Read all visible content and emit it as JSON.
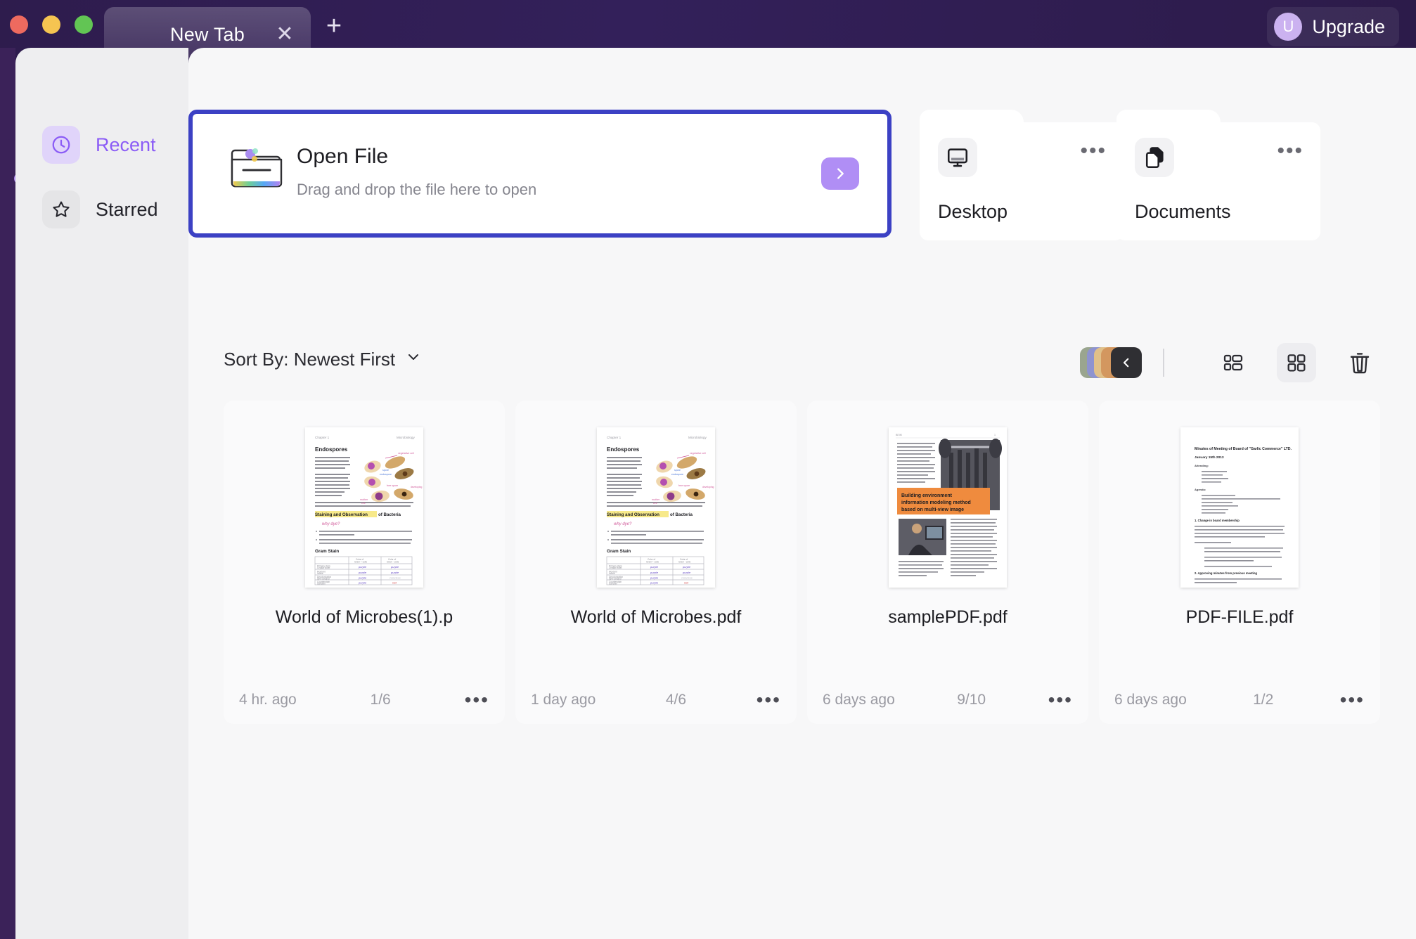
{
  "window": {
    "tab_title": "New Tab",
    "tab_close_icon": "close-icon",
    "new_tab_icon": "plus-icon",
    "upgrade_label": "Upgrade",
    "upgrade_avatar_letter": "U",
    "accent_purple": "#8b5cf6",
    "focus_border": "#3c41c4",
    "titlebar_bg": "#2e1c4d"
  },
  "sidebar": {
    "items": [
      {
        "label": "Recent",
        "icon": "clock-icon",
        "active": true
      },
      {
        "label": "Starred",
        "icon": "star-icon",
        "active": false
      }
    ]
  },
  "open_file": {
    "title": "Open File",
    "subtitle": "Drag and drop the file here to open",
    "icon": "folder-icon",
    "go_icon": "chevron-right-icon"
  },
  "shortcuts": [
    {
      "label": "Desktop",
      "icon": "monitor-icon",
      "menu_icon": "more-horizontal-icon"
    },
    {
      "label": "Documents",
      "icon": "documents-icon",
      "menu_icon": "more-horizontal-icon"
    }
  ],
  "toolbar": {
    "sort_label": "Sort By: Newest First",
    "sort_caret_icon": "chevron-down-icon",
    "color_stack_icon": "chevron-left-icon",
    "color_chips": [
      "#9aa58f",
      "#8e93d0",
      "#e0c089",
      "#d3975f"
    ],
    "list_view_icon": "list-view-icon",
    "grid_view_icon": "grid-view-icon",
    "trash_icon": "trash-icon",
    "active_view": "grid"
  },
  "files": [
    {
      "name": "World of Microbes(1).p",
      "time": "4 hr. ago",
      "pages": "1/6",
      "menu_icon": "more-horizontal-icon",
      "thumb_kind": "microbes",
      "thumb": {
        "heading": "Endospores",
        "highlight": "Staining and Observation of Bacteria",
        "subheading": "Gram Stain"
      }
    },
    {
      "name": "World of Microbes.pdf",
      "time": "1 day ago",
      "pages": "4/6",
      "menu_icon": "more-horizontal-icon",
      "thumb_kind": "microbes",
      "thumb": {
        "heading": "Endospores",
        "highlight": "Staining and Observation of Bacteria",
        "subheading": "Gram Stain"
      }
    },
    {
      "name": "samplePDF.pdf",
      "time": "6 days ago",
      "pages": "9/10",
      "menu_icon": "more-horizontal-icon",
      "thumb_kind": "paper",
      "thumb": {
        "banner": "Building environment information modeling method based on multi-view image"
      }
    },
    {
      "name": "PDF-FILE.pdf",
      "time": "6 days ago",
      "pages": "1/2",
      "menu_icon": "more-horizontal-icon",
      "thumb_kind": "minutes",
      "thumb": {
        "heading": "Minutes of Meeting of Board of \"Garlic Commerce\" LTD.",
        "subheading": "January 15th 2013"
      }
    }
  ]
}
